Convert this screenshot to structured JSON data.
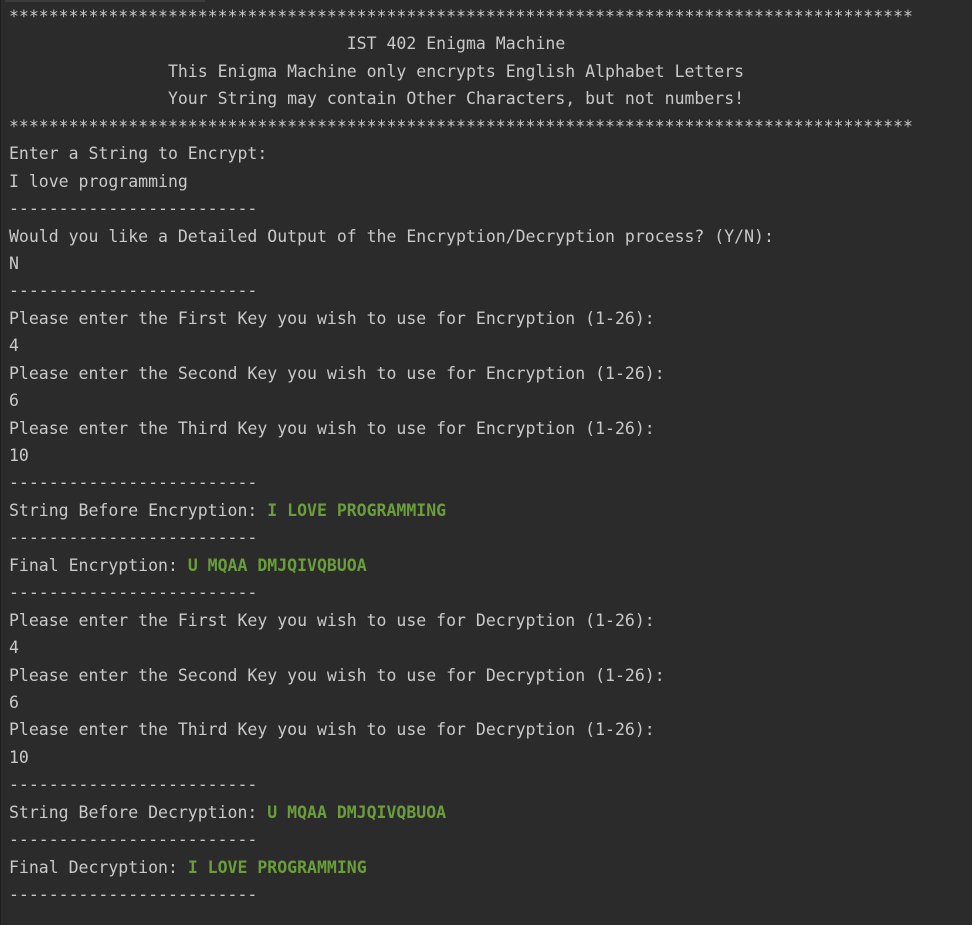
{
  "colors": {
    "background": "#2b2b2b",
    "text": "#c9c9c9",
    "highlight": "#6a9e3a"
  },
  "console": {
    "stars": "*******************************************************************************************",
    "separator": "-------------------------",
    "banner": {
      "title": "                                  IST 402 Enigma Machine",
      "line1": "                This Enigma Machine only encrypts English Alphabet Letters",
      "line2": "                Your String may contain Other Characters, but not numbers!"
    },
    "prompt_string": "Enter a String to Encrypt:",
    "input_string": "I love programming",
    "prompt_detailed": "Would you like a Detailed Output of the Encryption/Decryption process? (Y/N):",
    "input_detailed": "N",
    "enc": {
      "prompt_key1": "Please enter the First Key you wish to use for Encryption (1-26):",
      "key1": "4",
      "prompt_key2": "Please enter the Second Key you wish to use for Encryption (1-26):",
      "key2": "6",
      "prompt_key3": "Please enter the Third Key you wish to use for Encryption (1-26):",
      "key3": "10",
      "before_label": "String Before Encryption: ",
      "before_value": "I LOVE PROGRAMMING",
      "final_label": "Final Encryption: ",
      "final_value": "U MQAA DMJQIVQBUOA"
    },
    "dec": {
      "prompt_key1": "Please enter the First Key you wish to use for Decryption (1-26):",
      "key1": "4",
      "prompt_key2": "Please enter the Second Key you wish to use for Decryption (1-26):",
      "key2": "6",
      "prompt_key3": "Please enter the Third Key you wish to use for Decryption (1-26):",
      "key3": "10",
      "before_label": "String Before Decryption: ",
      "before_value": "U MQAA DMJQIVQBUOA",
      "final_label": "Final Decryption: ",
      "final_value": "I LOVE PROGRAMMING"
    }
  }
}
